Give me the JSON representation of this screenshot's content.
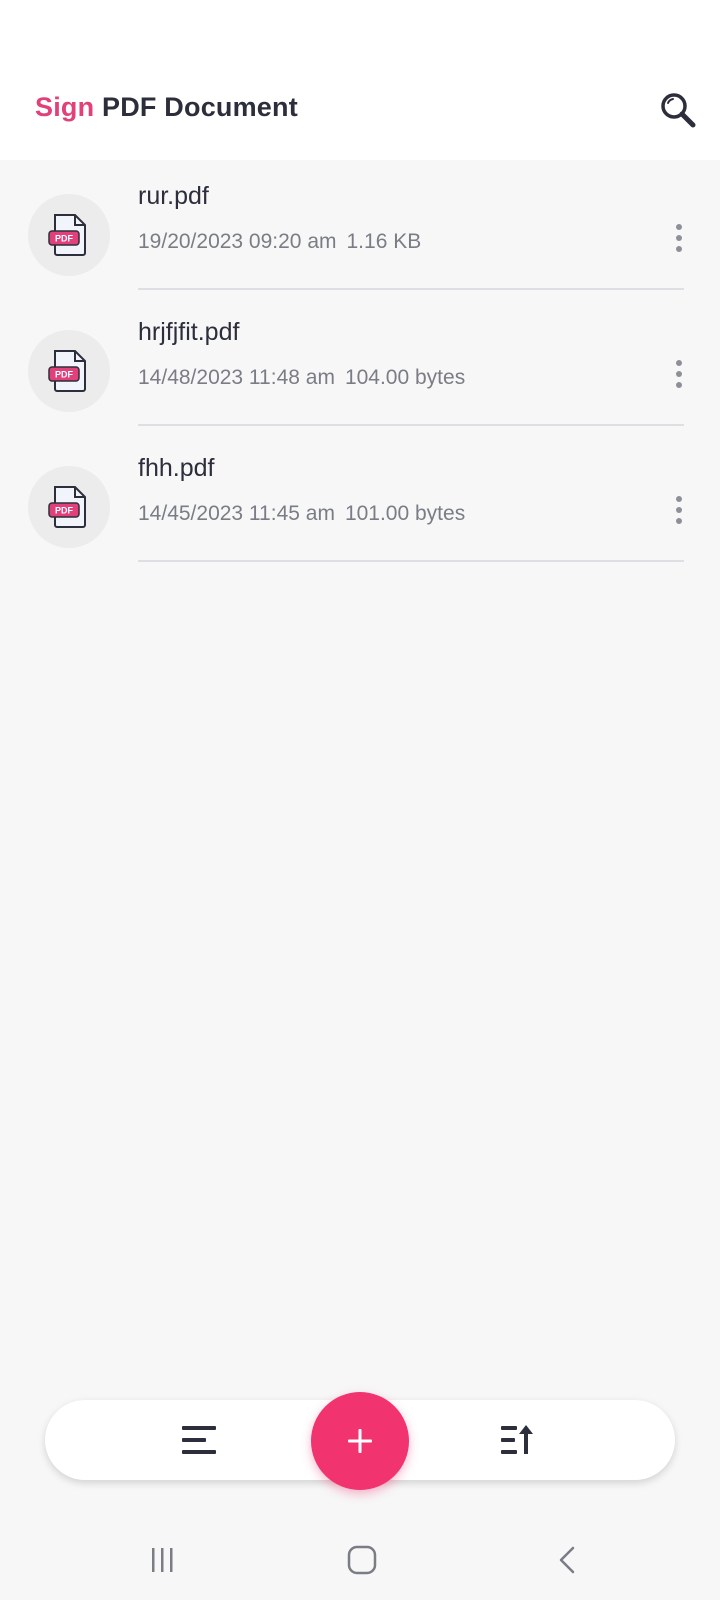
{
  "header": {
    "title_accent": "Sign",
    "title_rest": " PDF Document",
    "search_icon": "search-icon"
  },
  "colors": {
    "accent": "#e2407a",
    "fab": "#f1336f",
    "text_primary": "#2c2f3b",
    "text_secondary": "#7a7d85"
  },
  "files": [
    {
      "name": "rur.pdf",
      "date": "19/20/2023 09:20 am",
      "size": "1.16 KB"
    },
    {
      "name": "hrjfjfit.pdf",
      "date": "14/48/2023 11:48 am",
      "size": "104.00 bytes"
    },
    {
      "name": "fhh.pdf",
      "date": "14/45/2023 11:45 am",
      "size": "101.00 bytes"
    }
  ],
  "file_icon_label": "PDF",
  "bottom_bar": {
    "left_icon": "menu-lines-icon",
    "fab_icon": "plus-icon",
    "right_icon": "sort-icon"
  },
  "system_nav": [
    "recent-apps-icon",
    "home-icon",
    "back-icon"
  ]
}
